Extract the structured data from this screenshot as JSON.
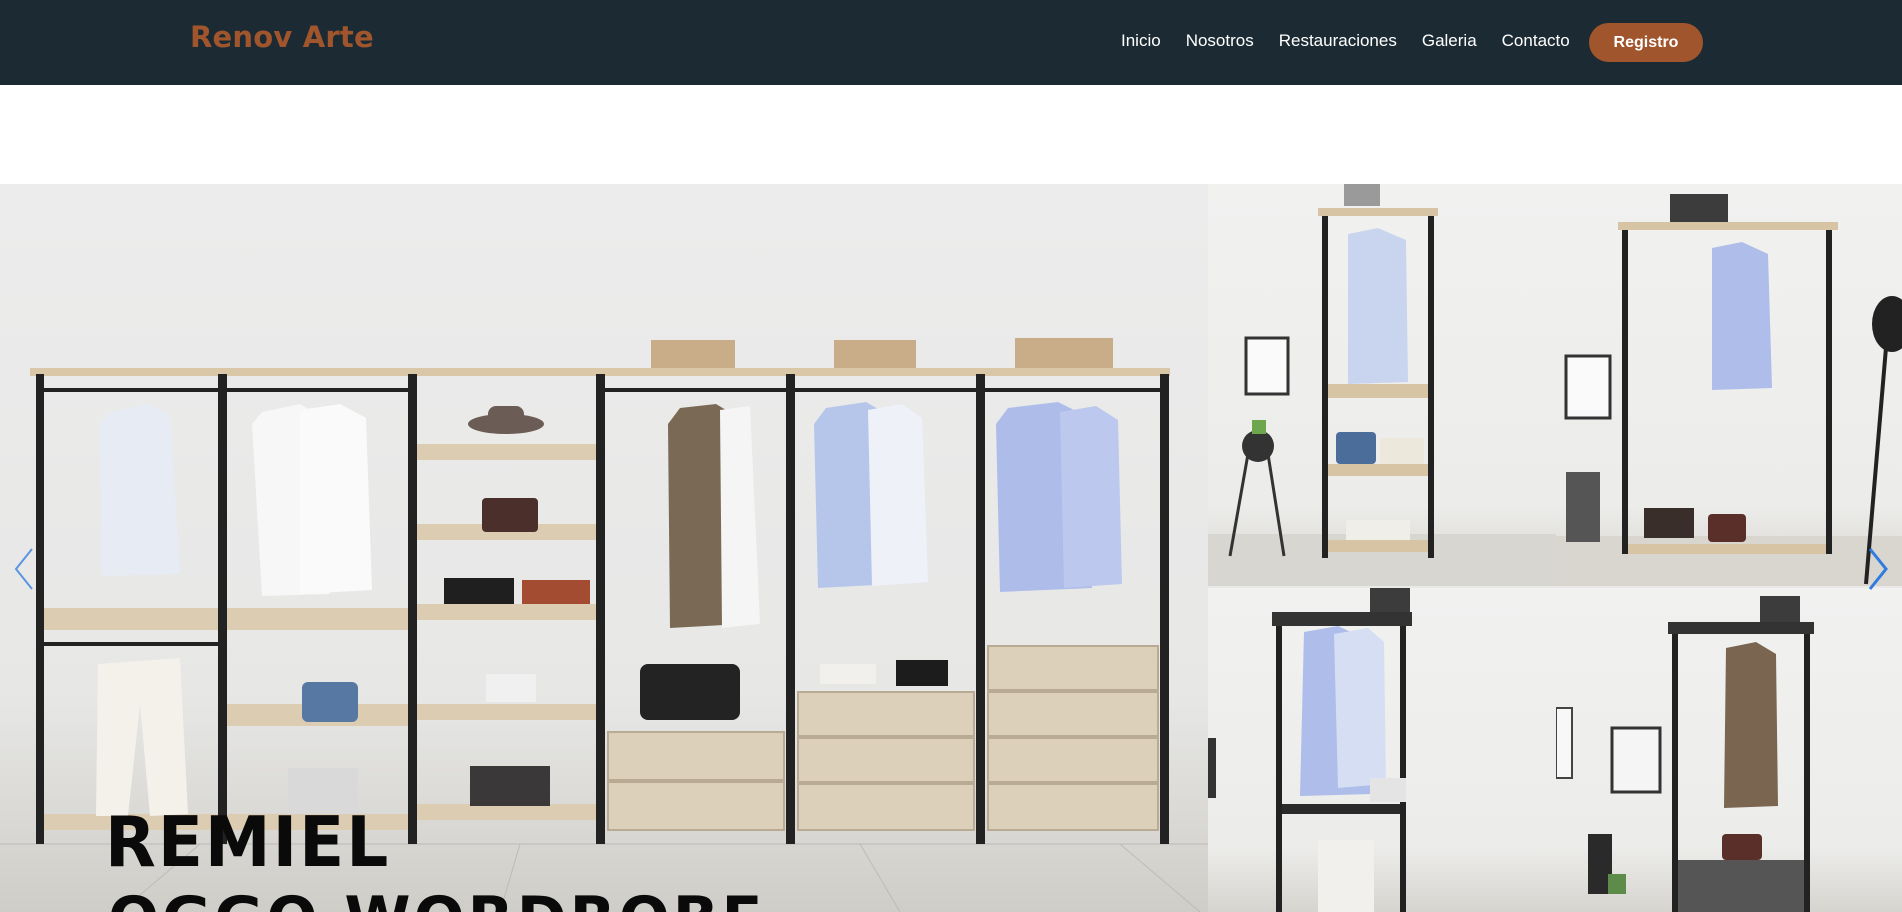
{
  "brand": {
    "name": "Renov Arte"
  },
  "nav": {
    "links": [
      "Inicio",
      "Nosotros",
      "Restauraciones",
      "Galeria",
      "Contacto"
    ],
    "register_label": "Registro"
  },
  "hero": {
    "title": "REMIEL",
    "subtitle": "OGGO WORDROBE"
  },
  "colors": {
    "navbar_bg": "#1c2b33",
    "brand_accent": "#a0552c",
    "carousel_arrow": "#4a8fe0"
  },
  "icons": {
    "prev": "chevron-left-icon",
    "next": "chevron-right-icon"
  }
}
